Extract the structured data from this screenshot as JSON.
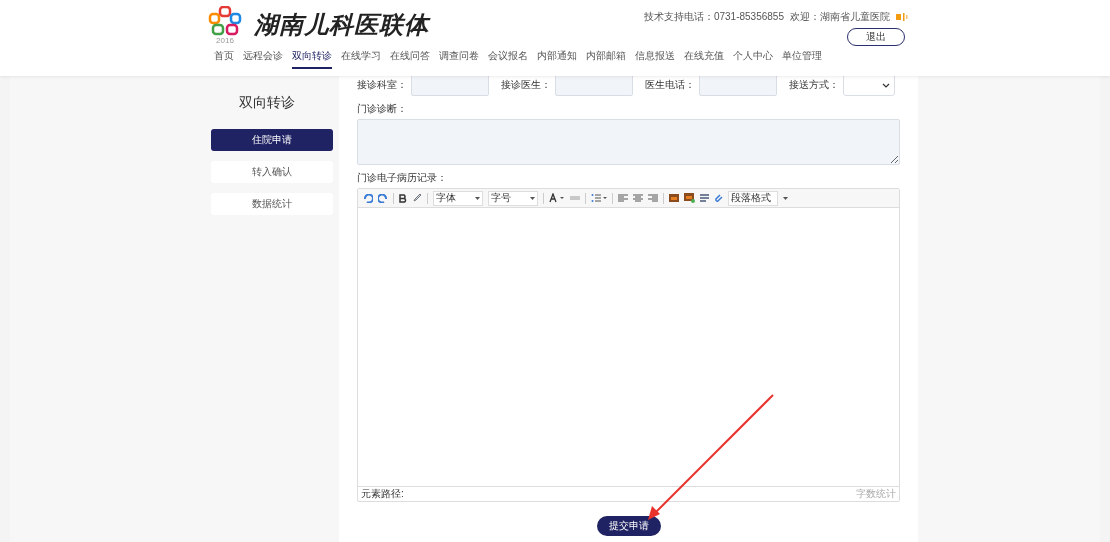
{
  "header": {
    "logo_year": "2016",
    "site_title": "湖南儿科医联体",
    "support": "技术支持电话：0731-85356855",
    "welcome": "欢迎：湖南省儿童医院",
    "logout": "退出"
  },
  "nav": [
    {
      "label": "首页",
      "selected": false
    },
    {
      "label": "远程会诊",
      "selected": false
    },
    {
      "label": "双向转诊",
      "selected": true
    },
    {
      "label": "在线学习",
      "selected": false
    },
    {
      "label": "在线问答",
      "selected": false
    },
    {
      "label": "调查问卷",
      "selected": false
    },
    {
      "label": "会议报名",
      "selected": false
    },
    {
      "label": "内部通知",
      "selected": false
    },
    {
      "label": "内部邮箱",
      "selected": false
    },
    {
      "label": "信息报送",
      "selected": false
    },
    {
      "label": "在线充值",
      "selected": false
    },
    {
      "label": "个人中心",
      "selected": false
    },
    {
      "label": "单位管理",
      "selected": false
    }
  ],
  "sidebar": {
    "title": "双向转诊",
    "items": [
      {
        "label": "住院申请",
        "selected": true
      },
      {
        "label": "转入确认",
        "selected": false
      },
      {
        "label": "数据统计",
        "selected": false
      }
    ]
  },
  "form": {
    "fields": [
      {
        "label": "接诊科室：",
        "kind": "input"
      },
      {
        "label": "接诊医生：",
        "kind": "input"
      },
      {
        "label": "医生电话：",
        "kind": "input"
      },
      {
        "label": "接送方式：",
        "kind": "select"
      }
    ],
    "diagnosis_label": "门诊诊断：",
    "record_label": "门诊电子病历记录：",
    "editor": {
      "font": "字体",
      "size": "字号",
      "paragraph": "段落格式",
      "path_label": "元素路径:",
      "word_count": "字数统计"
    },
    "submit": "提交申请"
  }
}
